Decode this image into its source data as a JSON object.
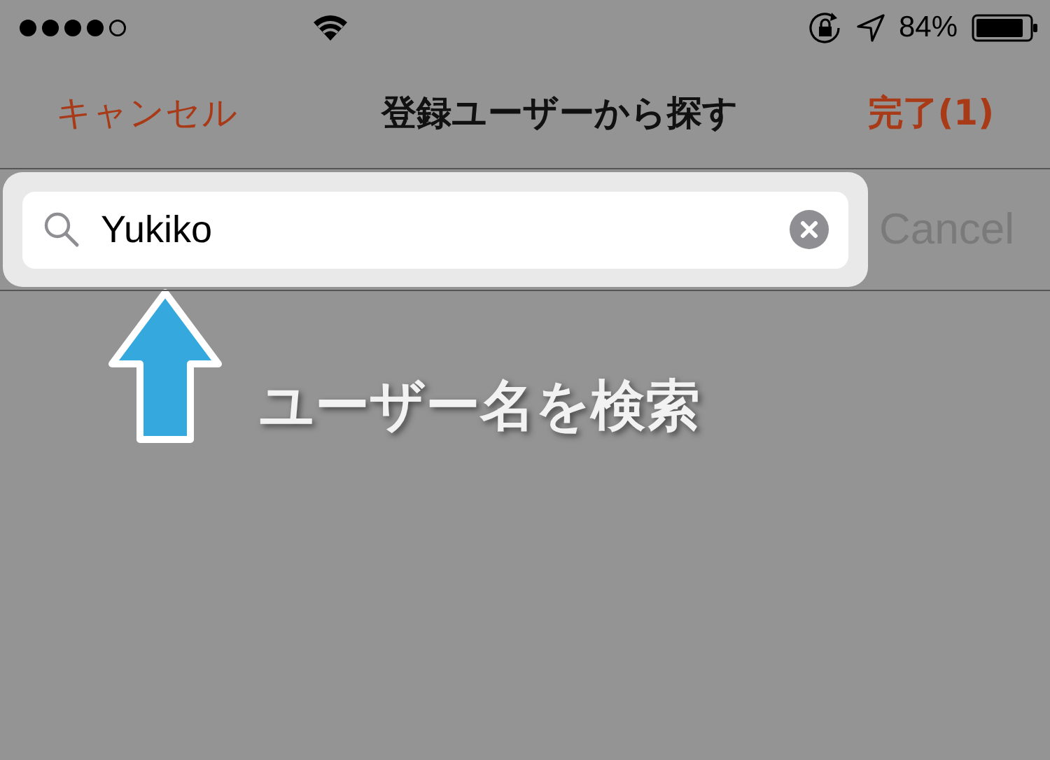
{
  "status_bar": {
    "battery": "84%"
  },
  "nav_bar": {
    "left_button": "キャンセル",
    "title": "登録ユーザーから探す",
    "right_button": "完了(1)"
  },
  "search": {
    "value": "Yukiko",
    "cancel": "Cancel"
  },
  "annotation": {
    "text": "ユーザー名を検索"
  }
}
